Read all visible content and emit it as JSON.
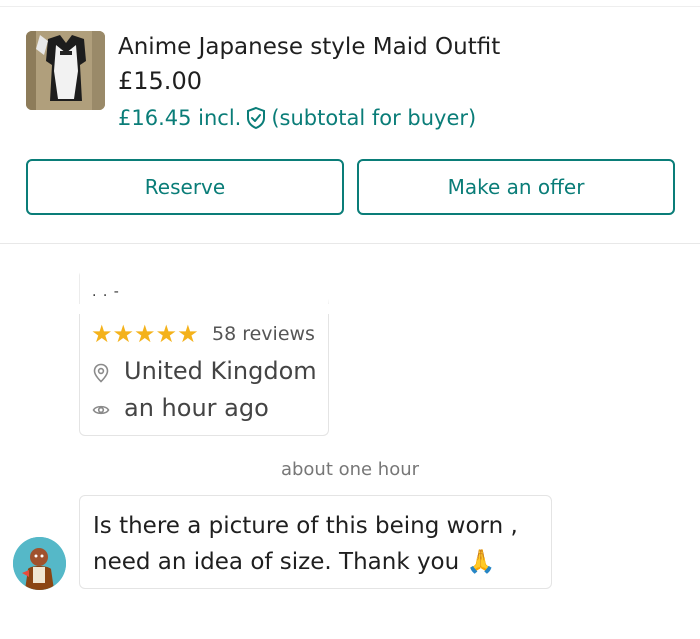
{
  "product": {
    "title": "Anime Japanese style Maid Outfit",
    "price": "£15.00",
    "price_incl": "£16.45 incl.",
    "subtotal_note": "(subtotal for buyer)",
    "accent_color": "#0a7d78"
  },
  "actions": {
    "reserve_label": "Reserve",
    "offer_label": "Make an offer"
  },
  "seller": {
    "name_partial": ". . -",
    "rating_stars": 5,
    "reviews": "58 reviews",
    "location": "United Kingdom",
    "last_seen": "an hour ago"
  },
  "conversation": {
    "timestamp": "about one hour",
    "message": "Is there a picture of this being worn , need an idea of size.  Thank you 🙏"
  },
  "icons": [
    "shield-check-icon",
    "star-icon",
    "location-pin-icon",
    "eye-icon",
    "avatar"
  ]
}
